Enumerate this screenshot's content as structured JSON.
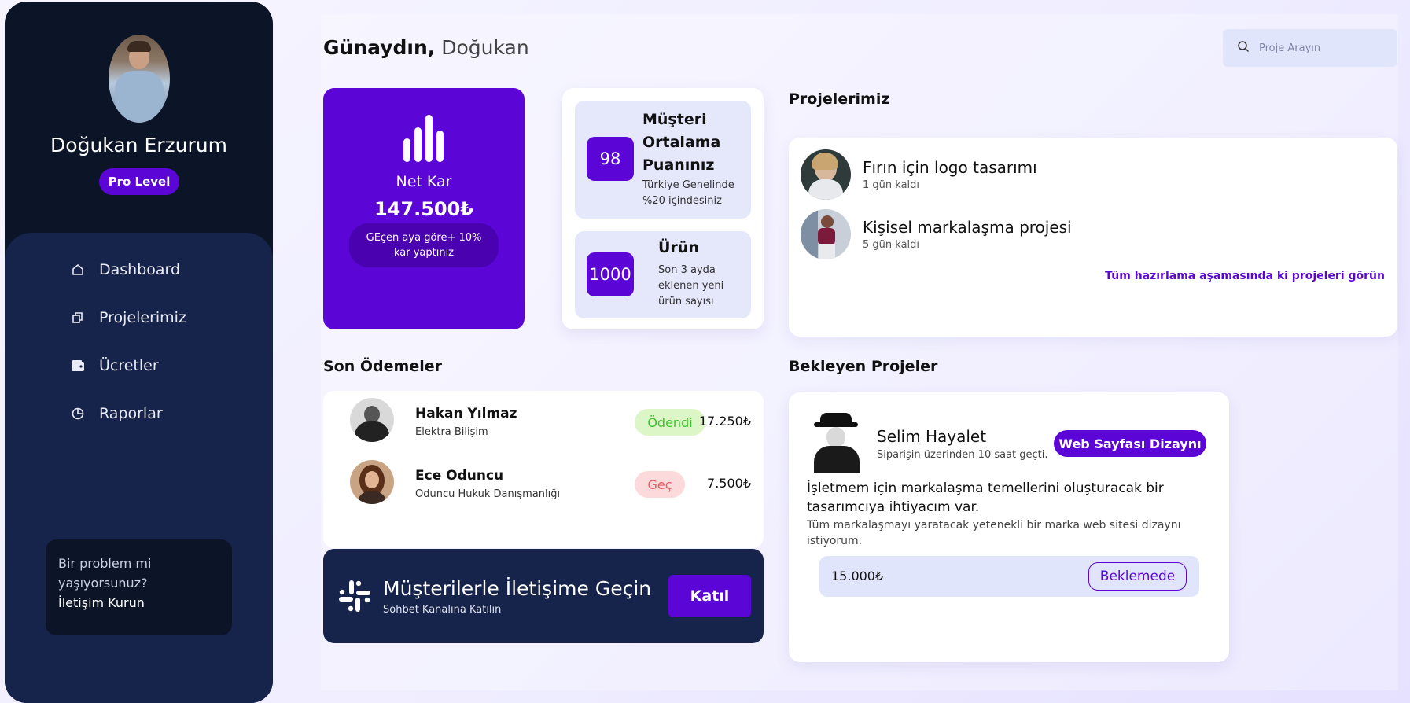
{
  "user": {
    "name": "Doğukan Erzurum",
    "level": "Pro Level"
  },
  "sidebar": {
    "items": [
      {
        "label": "Dashboard",
        "icon": "home-icon"
      },
      {
        "label": "Projelerimiz",
        "icon": "copy-icon"
      },
      {
        "label": "Ücretler",
        "icon": "wallet-icon"
      },
      {
        "label": "Raporlar",
        "icon": "pie-chart-icon"
      }
    ],
    "help": {
      "text": "Bir problem mi yaşıyorsunuz?",
      "link": "İletişim Kurun"
    }
  },
  "header": {
    "greeting": "Günaydın,",
    "name": "Doğukan",
    "search_placeholder": "Proje Arayın"
  },
  "netkar": {
    "label": "Net Kar",
    "value": "147.500₺",
    "note": "GEçen aya göre+ 10% kar yaptınız"
  },
  "stats": {
    "rating": {
      "value": "98",
      "title": "Müşteri Ortalama Puanınız",
      "sub": "Türkiye Genelinde %20 içindesiniz"
    },
    "products": {
      "value": "1000",
      "title": "Ürün",
      "sub": "Son 3 ayda eklenen yeni ürün sayısı"
    }
  },
  "projects": {
    "title": "Projelerimiz",
    "items": [
      {
        "name": "Fırın için logo tasarımı",
        "deadline": "1 gün kaldı"
      },
      {
        "name": "Kişisel markalaşma projesi",
        "deadline": "5 gün kaldı"
      }
    ],
    "more": "Tüm hazırlama aşamasında ki projeleri görün"
  },
  "payments": {
    "title": "Son Ödemeler",
    "items": [
      {
        "name": "Hakan Yılmaz",
        "company": "Elektra Bilişim",
        "status": "Ödendi",
        "amount": "17.250₺"
      },
      {
        "name": "Ece Oduncu",
        "company": "Oduncu Hukuk Danışmanlığı",
        "status": "Geç",
        "amount": "7.500₺"
      }
    ]
  },
  "slack": {
    "title": "Müşterilerle İletişime Geçin",
    "sub": "Sohbet Kanalına Katılın",
    "button": "Katıl"
  },
  "pending": {
    "title": "Bekleyen Projeler",
    "name": "Selim Hayalet",
    "time": "Siparişin üzerinden 10 saat geçti.",
    "tag": "Web Sayfası Dizaynı",
    "desc1": "İşletmem için markalaşma temellerini oluşturacak bir tasarımcıya ihtiyacım var.",
    "desc2": "Tüm markalaşmayı yaratacak yetenekli bir marka web sitesi dizaynı istiyorum.",
    "price": "15.000₺",
    "status": "Beklemede"
  },
  "colors": {
    "accent": "#5b06d6",
    "sidebar_dark": "#0b1527",
    "sidebar_panel": "#16234a",
    "paid_bg": "#dcf6c8",
    "paid_text": "#3cc42a",
    "late_bg": "#fcd9da",
    "late_text": "#ee5a5f"
  }
}
